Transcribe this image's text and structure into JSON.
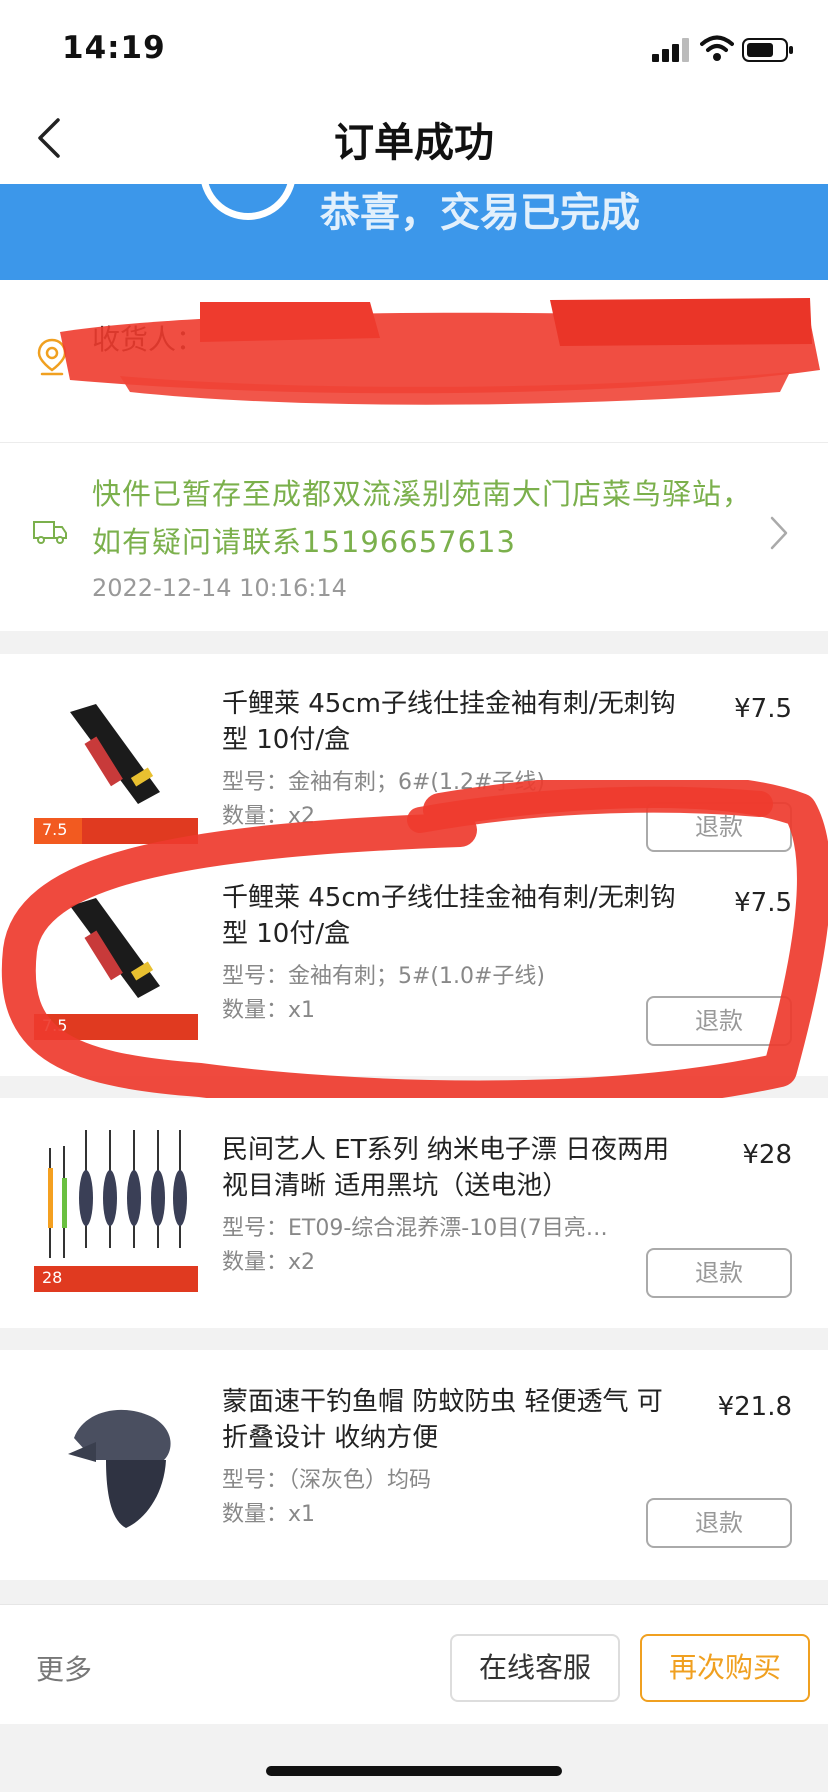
{
  "status_bar": {
    "time": "14:19"
  },
  "nav": {
    "title": "订单成功"
  },
  "banner": {
    "text": "恭喜，交易已完成"
  },
  "address": {
    "receiver_label": "收货人："
  },
  "logistics": {
    "message": "快件已暂存至成都双流溪别苑南大门店菜鸟驿站，如有疑问请联系15196657613",
    "time": "2022-12-14 10:16:14"
  },
  "items": [
    {
      "title": "千鲤莱 45cm子线仕挂金袖有刺/无刺钩型 10付/盒",
      "price": "¥7.5",
      "spec": "型号：金袖有刺；6#(1.2#子线)",
      "qty": "数量：x2",
      "refund": "退款",
      "thumb_price": "7.5"
    },
    {
      "title": "千鲤莱 45cm子线仕挂金袖有刺/无刺钩型 10付/盒",
      "price": "¥7.5",
      "spec": "型号：金袖有刺；5#(1.0#子线)",
      "qty": "数量：x1",
      "refund": "退款",
      "thumb_price": "7.5"
    },
    {
      "title": "民间艺人 ET系列 纳米电子漂 日夜两用 视目清晰 适用黑坑（送电池）",
      "price": "¥28",
      "spec": "型号：ET09-综合混养漂-10目(7目亮…",
      "qty": "数量：x2",
      "refund": "退款",
      "thumb_price": "28"
    },
    {
      "title": "蒙面速干钓鱼帽 防蚊防虫 轻便透气 可折叠设计 收纳方便",
      "price": "¥21.8",
      "spec": "型号：（深灰色）均码",
      "qty": "数量：x1",
      "refund": "退款"
    }
  ],
  "bottom_bar": {
    "more": "更多",
    "service": "在线客服",
    "rebuy": "再次购买"
  },
  "colors": {
    "banner": "#3c97ea",
    "logistics_text": "#7bb04c",
    "accent": "#f0a020",
    "redaction": "#ee3b2e"
  }
}
